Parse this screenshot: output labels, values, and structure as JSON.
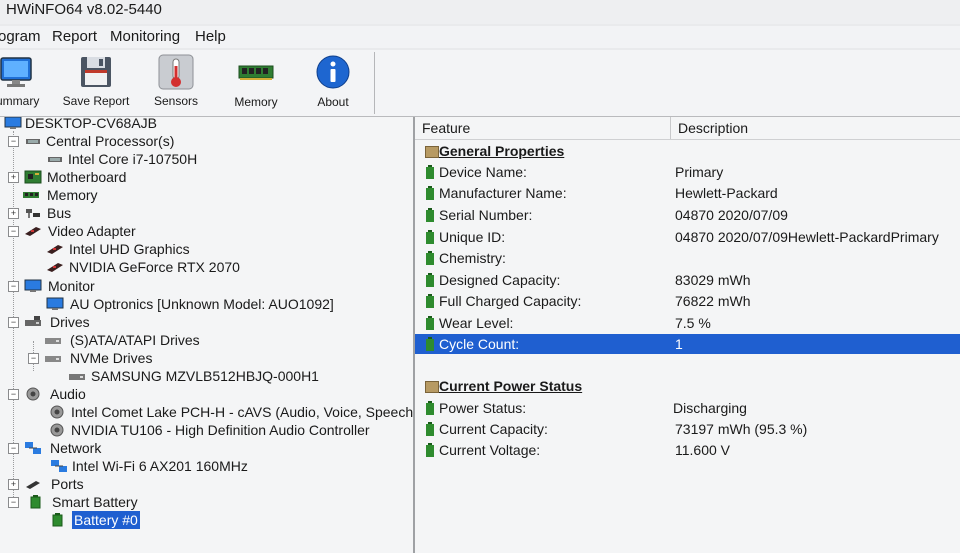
{
  "window": {
    "title": "HWiNFO64 v8.02-5440"
  },
  "menu": [
    "ogram",
    "Report",
    "Monitoring",
    "Help"
  ],
  "toolbar": {
    "buttons": [
      {
        "label": "ummary",
        "icon": "monitor-icon"
      },
      {
        "label": "Save Report",
        "icon": "floppy-disk-icon"
      },
      {
        "label": "Sensors",
        "icon": "thermometer-icon"
      },
      {
        "label": "Memory",
        "icon": "memory-module-icon"
      },
      {
        "label": "About",
        "icon": "info-icon"
      }
    ]
  },
  "tree": {
    "nodes": [
      {
        "label": "DESKTOP-CV68AJB",
        "icon": "computer-icon"
      },
      {
        "label": "Central Processor(s)",
        "icon": "cpu-icon"
      },
      {
        "label": "Intel Core i7-10750H",
        "icon": "cpu-icon"
      },
      {
        "label": "Motherboard",
        "icon": "motherboard-icon"
      },
      {
        "label": "Memory",
        "icon": "memory-module-icon"
      },
      {
        "label": "Bus",
        "icon": "bus-icon"
      },
      {
        "label": "Video Adapter",
        "icon": "video-card-icon"
      },
      {
        "label": "Intel UHD Graphics",
        "icon": "video-card-icon"
      },
      {
        "label": "NVIDIA GeForce RTX 2070",
        "icon": "video-card-icon"
      },
      {
        "label": "Monitor",
        "icon": "monitor-icon"
      },
      {
        "label": "AU Optronics [Unknown Model: AUO1092]",
        "icon": "monitor-icon"
      },
      {
        "label": "Drives",
        "icon": "drive-icon"
      },
      {
        "label": "(S)ATA/ATAPI Drives",
        "icon": "drive-icon"
      },
      {
        "label": "NVMe Drives",
        "icon": "drive-icon"
      },
      {
        "label": "SAMSUNG MZVLB512HBJQ-000H1",
        "icon": "drive-icon"
      },
      {
        "label": "Audio",
        "icon": "speaker-icon"
      },
      {
        "label": "Intel Comet Lake PCH-H - cAVS (Audio, Voice, Speech) [A",
        "icon": "speaker-icon"
      },
      {
        "label": "NVIDIA TU106 - High Definition Audio Controller",
        "icon": "speaker-icon"
      },
      {
        "label": "Network",
        "icon": "network-icon"
      },
      {
        "label": "Intel Wi-Fi 6 AX201 160MHz",
        "icon": "network-icon"
      },
      {
        "label": "Ports",
        "icon": "port-icon"
      },
      {
        "label": "Smart Battery",
        "icon": "battery-icon"
      },
      {
        "label": "Battery #0",
        "icon": "battery-icon",
        "selected": true
      }
    ]
  },
  "details": {
    "columns": {
      "feature": "Feature",
      "description": "Description"
    },
    "general_title": "General Properties",
    "general": [
      {
        "feature": "Device Name:",
        "value": "Primary"
      },
      {
        "feature": "Manufacturer Name:",
        "value": "Hewlett-Packard"
      },
      {
        "feature": "Serial Number:",
        "value": "04870 2020/07/09"
      },
      {
        "feature": "Unique ID:",
        "value": "04870 2020/07/09Hewlett-PackardPrimary"
      },
      {
        "feature": "Chemistry:",
        "value": ""
      },
      {
        "feature": "Designed Capacity:",
        "value": "83029 mWh"
      },
      {
        "feature": "Full Charged Capacity:",
        "value": "76822 mWh"
      },
      {
        "feature": "Wear Level:",
        "value": "7.5 %"
      },
      {
        "feature": "Cycle Count:",
        "value": "1",
        "selected": true
      }
    ],
    "power_title": "Current Power Status",
    "power": [
      {
        "feature": "Power Status:",
        "value": "Discharging"
      },
      {
        "feature": "Current Capacity:",
        "value": "73197 mWh (95.3 %)"
      },
      {
        "feature": "Current Voltage:",
        "value": "11.600 V"
      }
    ]
  },
  "colors": {
    "selection": "#1f5fd0",
    "battery_green": "#2e8b2e",
    "section_icon": "#b79a63"
  }
}
